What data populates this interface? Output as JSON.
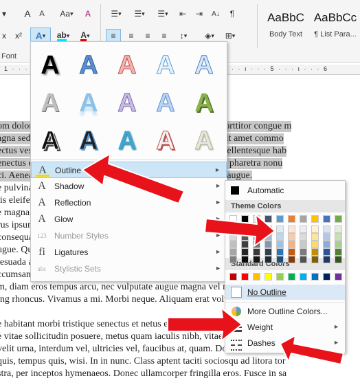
{
  "ribbon": {
    "font_size_label": "Aa",
    "superscript_label": "x²",
    "subscript_label": "x",
    "font_group_label": "Font",
    "styles": [
      {
        "preview": "AaBbC",
        "name": "Body Text"
      },
      {
        "preview": "AaBbCc",
        "name": "¶ List Para..."
      }
    ],
    "ruler_marks": "1 · · · ı · · · 1 · · · ı · · · 2 · · · ı · · · 3 · · · ı · · · 4 · · · ı · · · 5 · · · ı · · · 6"
  },
  "document": {
    "lines": [
      {
        "text": "om dolor sit amet, consectetuer adipiscing elit. Maecenas porttitor congue m",
        "selected": true
      },
      {
        "text": "agna sed pulvinar ultricies, purus lectus malesuada libero, sit amet commo",
        "selected": true
      },
      {
        "text": "ectus vestibulum urna fringilla ultrices. Phasellus a tellus. Pellentesque hab",
        "selected": true
      },
      {
        "text": "enectus et netus et malesuada fames ac turpis egestas. Proin pharetra nonu",
        "selected": true
      },
      {
        "text": "ci. Aenean nec lorem. In porttitor. Donec laoreet nonummy augue.",
        "selected": true
      },
      {
        "text": "e pulvinar ligula. Vivamus sagittis. Maecenas ante. Fusce posuere, magna",
        "selected": false
      },
      {
        "text": "tis eleifend ligula, eget malesuada dolor. Curabitur sapien ipsum, egestas",
        "selected": false
      },
      {
        "text": "e magna. Nunc accumsan aliquam urna. Vestibulum ullamcorper. Pellentesq",
        "selected": false
      },
      {
        "text": "rus ipsum, luctus at, gravida a, tincidunt eget, metus. Donec condimentum",
        "selected": false
      },
      {
        "text": "consequat. Donec non justo. Curabitur consectetuer scelerisque turpis. Ves",
        "selected": false
      },
      {
        "text": "ugue. Quisque hendrerit tortor in massa. Phasellus velit. Nam sodales",
        "selected": false
      },
      {
        "text": "lesuada arcu. Sed a lacus. Nullam sed felis. Cras porttitor, nisi ac v",
        "selected": false
      },
      {
        "text": "ccumsan id, felis. Pellentesque cursus sagittis felis. Pellentesque tor",
        "selected": false
      },
      {
        "text": "m, diam eros tempus arcu, nec vulputate augue magna vel risus. Cras non",
        "selected": false
      },
      {
        "text": "ing rhoncus. Vivamus a mi. Morbi neque. Aliquam erat volutpat. Integer ult",
        "selected": false
      },
      {
        "text": "",
        "selected": false
      },
      {
        "text": "e habitant morbi tristique senectus et netus et malesuada fames ac turpis",
        "selected": false
      },
      {
        "text": "e vitae sollicitudin posuere, metus quam iaculis nibh, vitae scelerisque nu",
        "selected": false
      },
      {
        "text": "velit urna, interdum vel, ultricies vel, faucibus at, quam. Donec elit est, conse",
        "selected": false
      },
      {
        "text": "quis, tempus quis, wisi. In in nunc. Class aptent taciti sociosqu ad litora tor",
        "selected": false
      },
      {
        "text": "stra, per inceptos hymenaeos. Donec ullamcorper fringilla eros. Fusce in sa",
        "selected": false
      }
    ]
  },
  "gallery_glyph": "A",
  "effects_menu": {
    "items": [
      {
        "label": "Outline",
        "icon": "A",
        "arrow": "►"
      },
      {
        "label": "Shadow",
        "icon": "A",
        "arrow": "►"
      },
      {
        "label": "Reflection",
        "icon": "A",
        "arrow": "►"
      },
      {
        "label": "Glow",
        "icon": "A",
        "arrow": "►"
      },
      {
        "label": "Number Styles",
        "icon": "123",
        "arrow": "►"
      },
      {
        "label": "Ligatures",
        "icon": "fi",
        "arrow": "►"
      },
      {
        "label": "Stylistic Sets",
        "icon": "abc",
        "arrow": "►"
      }
    ]
  },
  "outline_menu": {
    "automatic_label": "Automatic",
    "theme_colors_label": "Theme Colors",
    "standard_colors_label": "Standard Colors",
    "no_outline_label": "No Outline",
    "more_colors_label": "More Outline Colors...",
    "weight_label": "Weight",
    "dashes_label": "Dashes",
    "arrow": "►",
    "theme_top_row": [
      "#ffffff",
      "#000000",
      "#e7e6e6",
      "#44546a",
      "#5b9bd5",
      "#ed7d31",
      "#a5a5a5",
      "#ffc000",
      "#4472c4",
      "#70ad47"
    ],
    "theme_shades": [
      [
        "#f2f2f2",
        "#7f7f7f",
        "#d0cece",
        "#d6dce4",
        "#deebf6",
        "#fbe5d5",
        "#ededed",
        "#fff2cc",
        "#dae3f3",
        "#e2efd9"
      ],
      [
        "#d8d8d8",
        "#595959",
        "#aeabab",
        "#adb9ca",
        "#bdd7ee",
        "#f7cbac",
        "#dbdbdb",
        "#fee599",
        "#b4c6e7",
        "#c5e0b3"
      ],
      [
        "#bfbfbf",
        "#3f3f3f",
        "#757070",
        "#8496b0",
        "#9dc3e6",
        "#f4b183",
        "#c9c9c9",
        "#ffd965",
        "#8eaadb",
        "#a8d08d"
      ],
      [
        "#a5a5a5",
        "#262626",
        "#3a3838",
        "#323f4f",
        "#2e75b5",
        "#c55a11",
        "#7b7b7b",
        "#bf9000",
        "#2f5496",
        "#538135"
      ],
      [
        "#7f7f7f",
        "#0c0c0c",
        "#171616",
        "#222a35",
        "#1e4e79",
        "#833c0b",
        "#525252",
        "#7f6000",
        "#1f3864",
        "#375623"
      ]
    ],
    "standard_colors": [
      "#c00000",
      "#ff0000",
      "#ffc000",
      "#ffff00",
      "#92d050",
      "#00b050",
      "#00b0f0",
      "#0070c0",
      "#002060",
      "#7030a0"
    ]
  }
}
